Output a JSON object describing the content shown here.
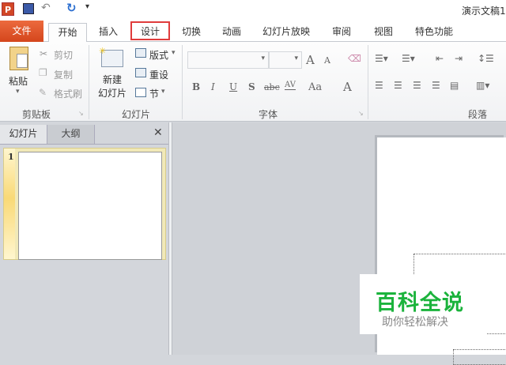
{
  "title": "演示文稿1",
  "tabs": [
    {
      "label": "文件"
    },
    {
      "label": "开始"
    },
    {
      "label": "插入"
    },
    {
      "label": "设计"
    },
    {
      "label": "切换"
    },
    {
      "label": "动画"
    },
    {
      "label": "幻灯片放映"
    },
    {
      "label": "审阅"
    },
    {
      "label": "视图"
    },
    {
      "label": "特色功能"
    }
  ],
  "clipboard": {
    "paste": "粘贴",
    "cut": "剪切",
    "copy": "复制",
    "format_painter": "格式刷",
    "label": "剪贴板"
  },
  "slides": {
    "new_slide_1": "新建",
    "new_slide_2": "幻灯片",
    "layout": "版式",
    "reset": "重设",
    "section": "节",
    "label": "幻灯片"
  },
  "font": {
    "label": "字体",
    "bold": "B",
    "italic": "I",
    "underline": "U",
    "shadow": "S",
    "strike": "abc",
    "spacing": "AV",
    "case": "Aa",
    "color": "A",
    "grow": "A",
    "shrink": "A"
  },
  "paragraph": {
    "label": "段落"
  },
  "pane": {
    "tab_slides": "幻灯片",
    "tab_outline": "大纲",
    "close": "✕",
    "slide_number": "1"
  },
  "watermark": {
    "title": "百科全说",
    "subtitle": "助你轻松解决"
  },
  "colors": {
    "file_tab": "#e0522a",
    "highlight": "#e03c3c",
    "watermark": "#1bb33c"
  }
}
